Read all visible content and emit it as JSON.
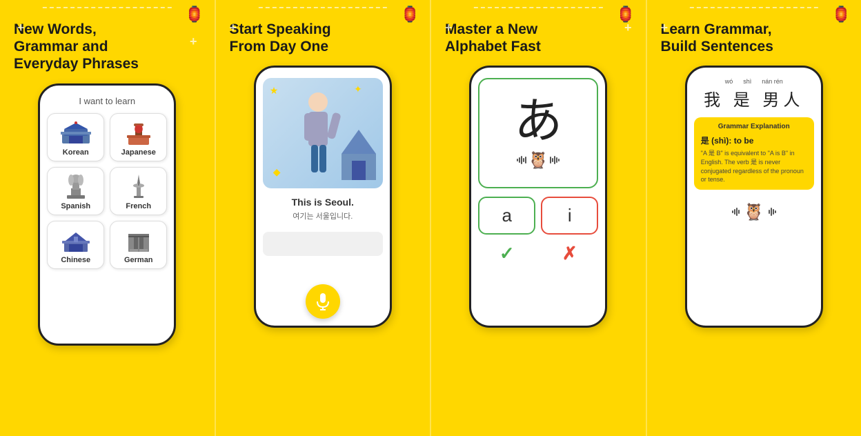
{
  "panels": [
    {
      "id": "panel1",
      "title": "New Words,\nGrammar and\nEveryday Phrases",
      "subtitle": "I want to learn",
      "languages": [
        {
          "name": "Korean",
          "emoji": "🏯"
        },
        {
          "name": "Japanese",
          "emoji": "⛩️"
        },
        {
          "name": "Spanish",
          "emoji": "⛪"
        },
        {
          "name": "French",
          "emoji": "🗼"
        },
        {
          "name": "Chinese",
          "emoji": "🏛️"
        },
        {
          "name": "German",
          "emoji": "🚪"
        }
      ]
    },
    {
      "id": "panel2",
      "title": "Start Speaking\nFrom Day One",
      "speech_main": "This is Seoul.",
      "speech_sub": "여기는 서울입니다.",
      "mic_icon": "🎤"
    },
    {
      "id": "panel3",
      "title": "Master a New\nAlphabet Fast",
      "hiragana": "あ",
      "answers": [
        "a",
        "i"
      ],
      "check": "✓",
      "cross": "✗"
    },
    {
      "id": "panel4",
      "title": "Learn Grammar,\nBuild Sentences",
      "pinyin": [
        "wó",
        "shì",
        "nán rén"
      ],
      "chinese": "我 是 男人",
      "grammar_title": "Grammar Explanation",
      "grammar_bold": "是 (shì): to be",
      "grammar_desc": "\"A 是 B\" is equivalent to \"A is B\" in English. The verb 是 is never conjugated regardless of the pronoun or tense."
    }
  ],
  "colors": {
    "background": "#FFD700",
    "phone_border": "#222222",
    "green": "#4CAF50",
    "red": "#e74c3c",
    "grammar_bg": "#FFD700"
  }
}
